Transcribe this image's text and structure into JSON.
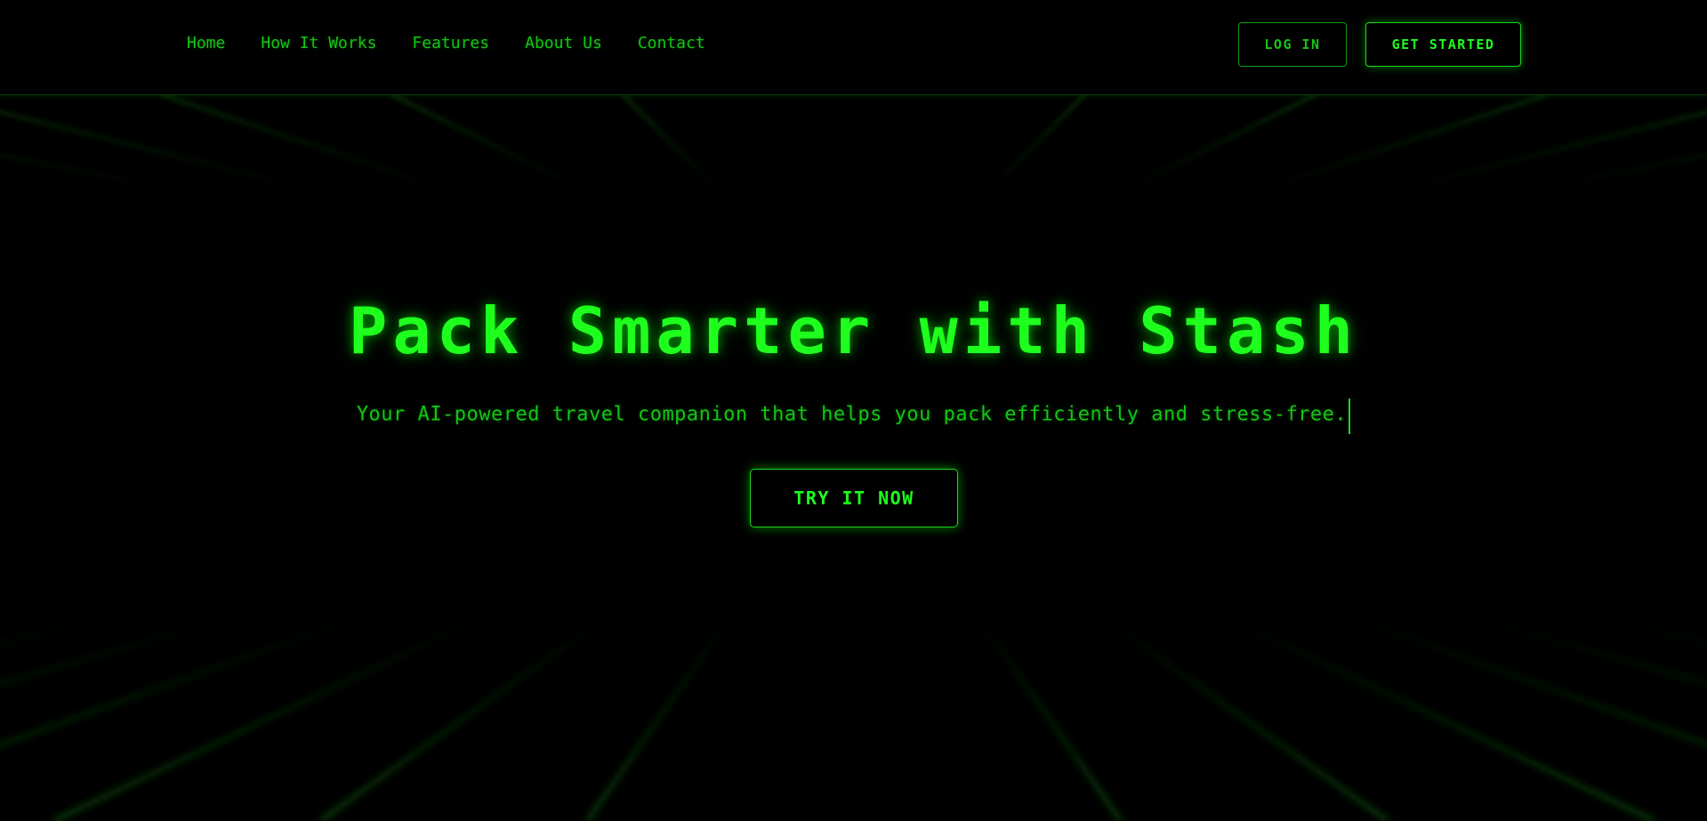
{
  "nav": {
    "links": [
      "Home",
      "How It Works",
      "Features",
      "About Us",
      "Contact"
    ],
    "login_label": "LOG IN",
    "get_started_label": "GET STARTED"
  },
  "hero": {
    "title": "Pack Smarter with Stash",
    "subtitle": "Your AI-powered travel companion that helps you pack efficiently and stress-free.",
    "cta_label": "TRY IT NOW"
  },
  "colors": {
    "background": "#000000",
    "accent": "#1eff1e",
    "text_green": "#16c416",
    "grid_green": "#0a4a0a"
  }
}
